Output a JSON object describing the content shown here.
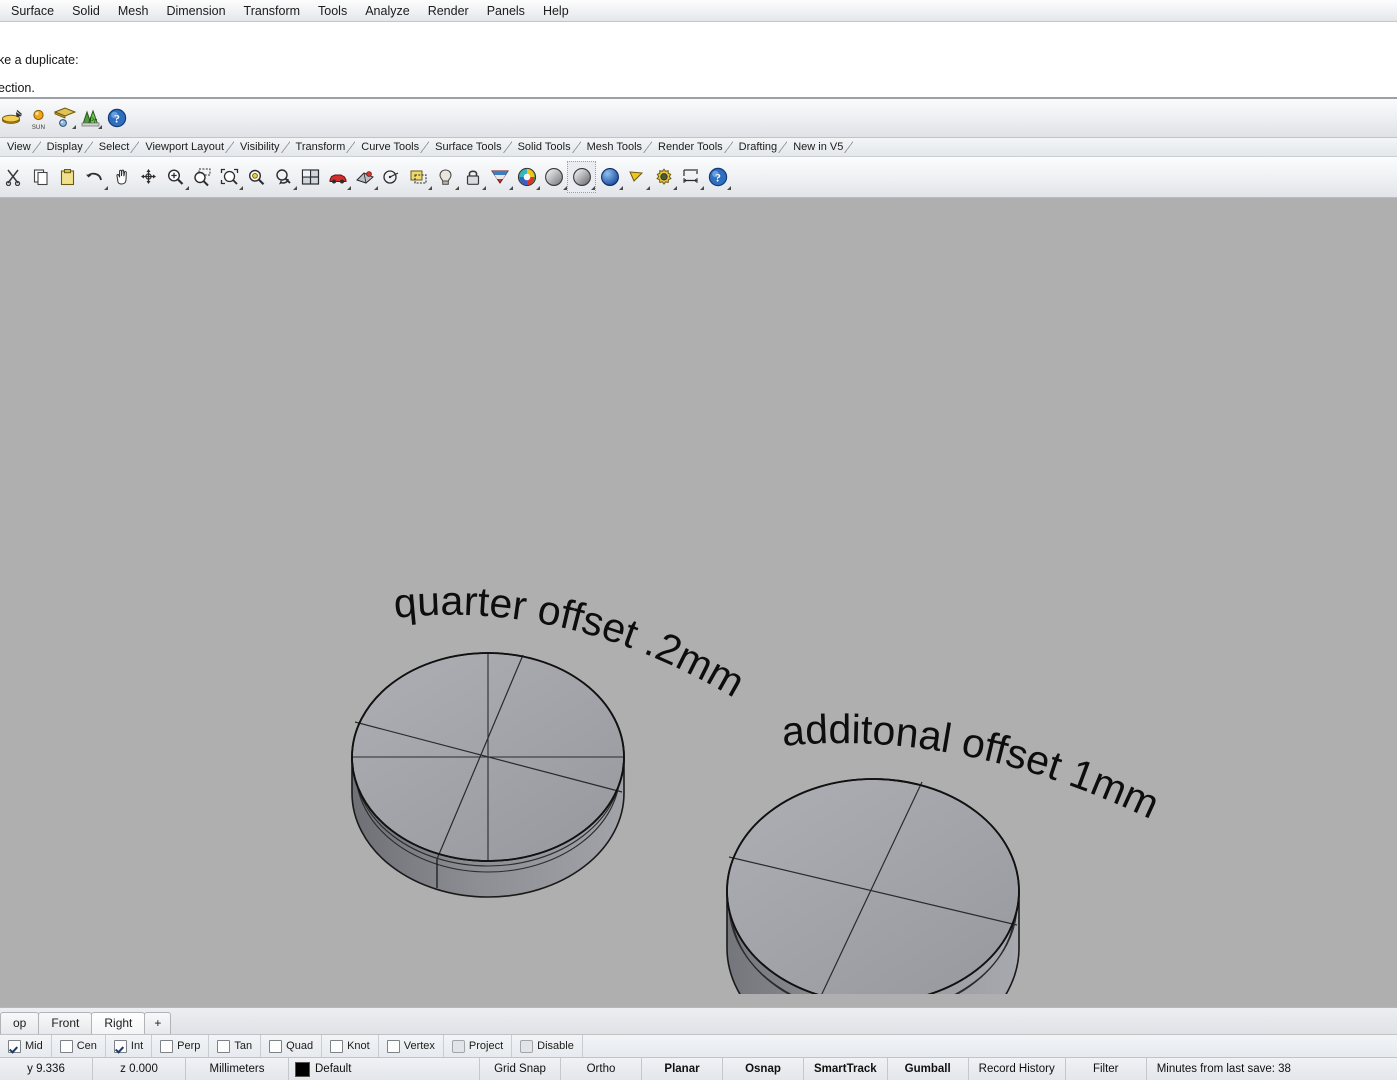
{
  "menu": {
    "items": [
      {
        "label": "Surface"
      },
      {
        "label": "Solid"
      },
      {
        "label": "Mesh"
      },
      {
        "label": "Dimension"
      },
      {
        "label": "Transform"
      },
      {
        "label": "Tools"
      },
      {
        "label": "Analyze"
      },
      {
        "label": "Render"
      },
      {
        "label": "Panels"
      },
      {
        "label": "Help"
      }
    ]
  },
  "command_history": {
    "line1": "ke a duplicate:",
    "line2": "ection."
  },
  "render_toolbar": {
    "icons": [
      {
        "name": "render-icon",
        "label": ""
      },
      {
        "name": "sun-icon",
        "label": "SUN"
      },
      {
        "name": "ground-plane-icon",
        "label": ""
      },
      {
        "name": "render-preview-icon",
        "label": ""
      },
      {
        "name": "help-icon",
        "label": ""
      }
    ]
  },
  "toolbar_tabs": {
    "items": [
      {
        "label": "View"
      },
      {
        "label": "Display"
      },
      {
        "label": "Select"
      },
      {
        "label": "Viewport Layout"
      },
      {
        "label": "Visibility"
      },
      {
        "label": "Transform"
      },
      {
        "label": "Curve Tools"
      },
      {
        "label": "Surface Tools"
      },
      {
        "label": "Solid Tools"
      },
      {
        "label": "Mesh Tools"
      },
      {
        "label": "Render Tools"
      },
      {
        "label": "Drafting"
      },
      {
        "label": "New in V5"
      }
    ]
  },
  "main_toolbar": {
    "icons": [
      {
        "name": "cut-icon"
      },
      {
        "name": "copy-icon"
      },
      {
        "name": "paste-icon"
      },
      {
        "name": "undo-icon"
      },
      {
        "name": "pan-icon"
      },
      {
        "name": "zoom-dynamic-icon"
      },
      {
        "name": "zoom-in-icon"
      },
      {
        "name": "zoom-window-icon"
      },
      {
        "name": "zoom-extents-icon"
      },
      {
        "name": "zoom-selected-icon"
      },
      {
        "name": "rotate-view-icon"
      },
      {
        "name": "four-view-icon"
      },
      {
        "name": "perspective-car-icon"
      },
      {
        "name": "shade-icon"
      },
      {
        "name": "circle-center-icon"
      },
      {
        "name": "named-view-icon"
      },
      {
        "name": "light-bulb-icon"
      },
      {
        "name": "lock-icon"
      },
      {
        "name": "material-icon"
      },
      {
        "name": "color-wheel-icon"
      },
      {
        "name": "shaded-sphere-icon"
      },
      {
        "name": "rendered-sphere-icon"
      },
      {
        "name": "blue-sphere-icon"
      },
      {
        "name": "spotlight-icon"
      },
      {
        "name": "settings-gear-icon"
      },
      {
        "name": "dimension-icon"
      },
      {
        "name": "help-question-icon"
      }
    ]
  },
  "viewport": {
    "background_color": "#afafaf",
    "annotations": [
      {
        "name": "quarter-offset-label",
        "text": "quarter offset .2mm"
      },
      {
        "name": "additional-offset-label",
        "text": "additonal offset 1mm"
      }
    ],
    "objects": [
      {
        "name": "left-disc",
        "face_color": "#a0a1a7",
        "side_color": "#8d8e95"
      },
      {
        "name": "right-disc",
        "face_color": "#a3a4aa",
        "side_color": "#8a8b92"
      }
    ]
  },
  "viewport_tabs": {
    "items": [
      {
        "label": "op",
        "selected": false
      },
      {
        "label": "Front",
        "selected": false
      },
      {
        "label": "Right",
        "selected": true
      }
    ],
    "add_label": "+"
  },
  "osnap": {
    "items": [
      {
        "label": "Mid",
        "checked": true,
        "style": "normal"
      },
      {
        "label": "Cen",
        "checked": false,
        "style": "normal"
      },
      {
        "label": "Int",
        "checked": true,
        "style": "normal"
      },
      {
        "label": "Perp",
        "checked": false,
        "style": "normal"
      },
      {
        "label": "Tan",
        "checked": false,
        "style": "normal"
      },
      {
        "label": "Quad",
        "checked": false,
        "style": "normal"
      },
      {
        "label": "Knot",
        "checked": false,
        "style": "normal"
      },
      {
        "label": "Vertex",
        "checked": false,
        "style": "normal"
      },
      {
        "label": "Project",
        "checked": false,
        "style": "dim"
      },
      {
        "label": "Disable",
        "checked": false,
        "style": "dim"
      }
    ]
  },
  "statusbar": {
    "coord_y": "y 9.336",
    "coord_z": "z 0.000",
    "units": "Millimeters",
    "layer": "Default",
    "layer_color": "#000000",
    "toggles": [
      {
        "label": "Grid Snap",
        "active": false
      },
      {
        "label": "Ortho",
        "active": false
      },
      {
        "label": "Planar",
        "active": true
      },
      {
        "label": "Osnap",
        "active": true
      },
      {
        "label": "SmartTrack",
        "active": true
      },
      {
        "label": "Gumball",
        "active": true
      },
      {
        "label": "Record History",
        "active": false
      },
      {
        "label": "Filter",
        "active": false
      }
    ],
    "save_info": "Minutes from last save: 38"
  }
}
